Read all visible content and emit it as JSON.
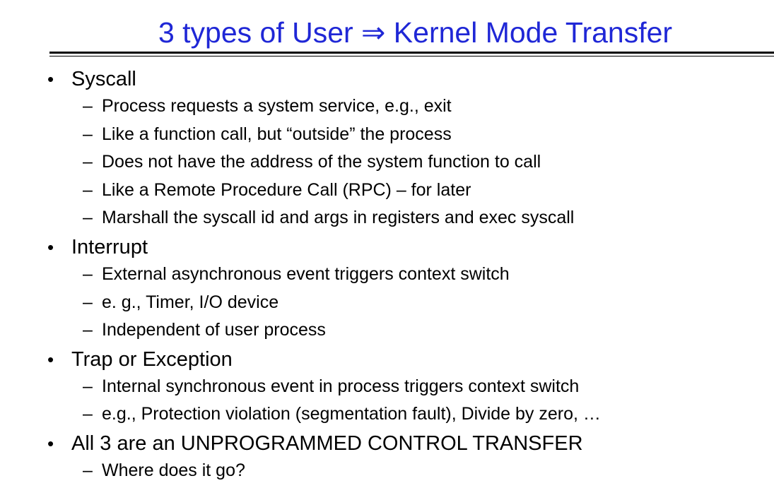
{
  "slide": {
    "title": "3 types of User ⇒ Kernel Mode Transfer",
    "bullet_glyph": "•",
    "dash_glyph": "–",
    "bullets": [
      {
        "text": "Syscall",
        "subs": [
          "Process requests a system service, e.g., exit",
          "Like a function call, but “outside” the process",
          "Does not have the address of the system function to call",
          "Like a Remote Procedure Call (RPC) – for later",
          "Marshall the syscall id and args in registers and exec syscall"
        ]
      },
      {
        "text": "Interrupt",
        "subs": [
          "External asynchronous event triggers context switch",
          "e. g., Timer, I/O device",
          "Independent of user process"
        ]
      },
      {
        "text": "Trap or Exception",
        "subs": [
          "Internal synchronous event in process triggers context switch",
          "e.g., Protection violation (segmentation fault), Divide by zero, …"
        ]
      },
      {
        "text": "All 3 are an UNPROGRAMMED CONTROL TRANSFER",
        "subs": [
          "Where does it go?"
        ]
      }
    ]
  }
}
